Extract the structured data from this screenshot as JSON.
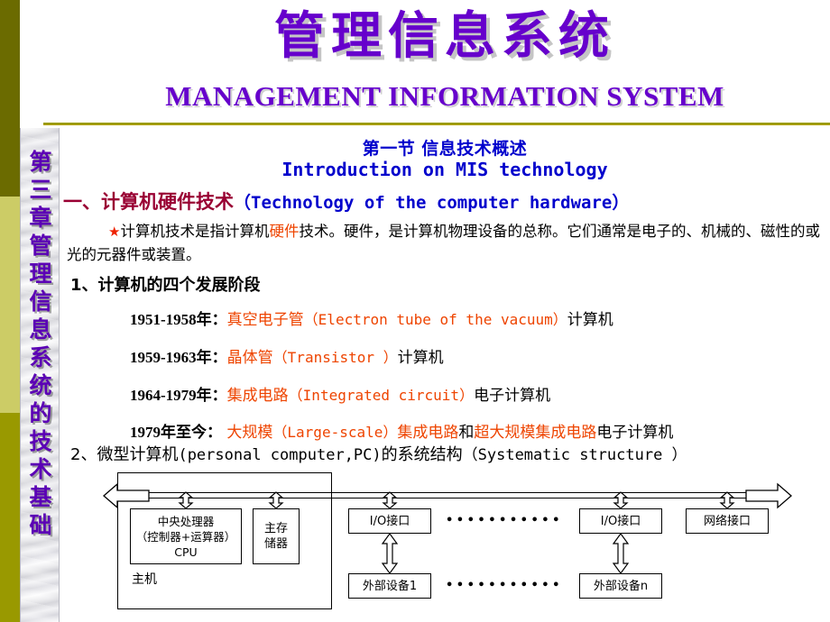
{
  "slide": {
    "title_cn": "管理信息系统",
    "title_en": "MANAGEMENT INFORMATION SYSTEM",
    "sidebar_text": "第三章 管理信息系统的技术基础",
    "accent_color": "#6600cc",
    "rule_color": "#999900",
    "band_colors": [
      "#6b6b00",
      "#cccc66",
      "#999900"
    ]
  },
  "section": {
    "heading_cn": "第一节 信息技术概述",
    "heading_en": "Introduction on MIS technology",
    "heading_color": "#0000cc"
  },
  "topic1": {
    "cn": "一、计算机硬件技术",
    "en": "（Technology of the computer hardware）",
    "cn_color": "#990033",
    "en_color": "#0000cc"
  },
  "paragraph1": {
    "bullet": "★",
    "part1": "计算机技术是指计算机",
    "highlight": "硬件",
    "part2": "技术。硬件，是计算机物理设备的总称。它们通常是电子的、机械的、磁性的或光的元器件或装置。",
    "highlight_color": "#ee4400",
    "bullet_color": "#ee2200"
  },
  "item1": {
    "label": "1、计算机的四个发展阶段",
    "stages": [
      {
        "years": "1951-1958年：",
        "term_cn": "真空电子管",
        "term_en": "（Electron tube of the vacuum）",
        "tail": "计算机"
      },
      {
        "years": "1959-1963年：",
        "term_cn": "晶体管",
        "term_en": "（Transistor ）",
        "tail": "计算机"
      },
      {
        "years": "1964-1979年：",
        "term_cn": "集成电路",
        "term_en": "（Integrated circuit）",
        "tail": "电子计算机"
      },
      {
        "years": "1979年至今：",
        "term_cn": "大规模",
        "term_en": "（Large-scale）",
        "term_cn2": "集成电路",
        "conj": "和",
        "term_cn3": "超大规模集成电路",
        "tail": "电子计算机"
      }
    ],
    "stage_term_color": "#ee4400"
  },
  "item2": {
    "prefix": "2、微型计算机",
    "mono1": "(personal computer,PC)",
    "middle": "的系统结构",
    "mono2": "（Systematic structure ）"
  },
  "diagram": {
    "host_label": "主机",
    "cpu": [
      "中央处理器",
      "（控制器+运算器）",
      "CPU"
    ],
    "memory": [
      "主存",
      "储器"
    ],
    "io_interface_1": "I/O接口",
    "io_interface_n": "I/O接口",
    "network_interface": "网络接口",
    "external_device_1": "外部设备1",
    "external_device_n": "外部设备n",
    "ellipsis": "•••••••••••",
    "line_color": "#000000"
  }
}
